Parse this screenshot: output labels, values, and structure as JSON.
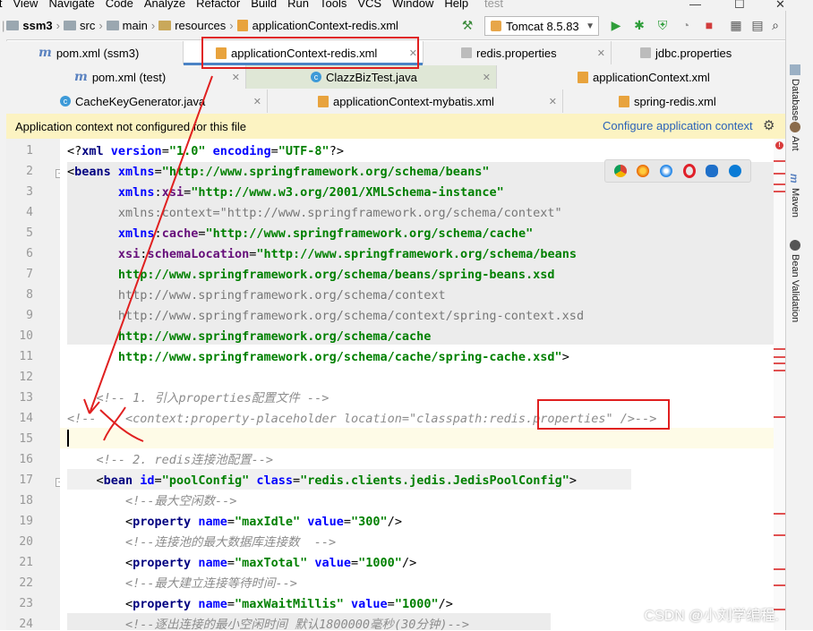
{
  "menu": {
    "items": [
      "it",
      "View",
      "Navigate",
      "Code",
      "Analyze",
      "Refactor",
      "Build",
      "Run",
      "Tools",
      "VCS",
      "Window",
      "Help"
    ],
    "project_title": "test"
  },
  "window_controls": {
    "minimize": "—",
    "maximize": "☐",
    "close": "✕"
  },
  "breadcrumb": {
    "project": "ssm3",
    "parts": [
      "src",
      "main",
      "resources"
    ],
    "file": "applicationContext-redis.xml"
  },
  "run_config": {
    "label": "Tomcat 8.5.83"
  },
  "tab_rows": [
    [
      {
        "label": "pom.xml (ssm3)",
        "icon": "m-icon",
        "active": false
      },
      {
        "label": "applicationContext-redis.xml",
        "icon": "xml-icon",
        "active": true
      },
      {
        "label": "redis.properties",
        "icon": "properties-icon",
        "active": false
      },
      {
        "label": "jdbc.properties",
        "icon": "properties-icon",
        "active": false
      }
    ],
    [
      {
        "label": "pom.xml (test)",
        "icon": "m-icon",
        "active": false
      },
      {
        "label": "ClazzBizTest.java",
        "icon": "class-icon",
        "active": false
      },
      {
        "label": "applicationContext.xml",
        "icon": "xml-icon",
        "active": false
      }
    ],
    [
      {
        "label": "CacheKeyGenerator.java",
        "icon": "class-icon",
        "active": false
      },
      {
        "label": "applicationContext-mybatis.xml",
        "icon": "xml-icon",
        "active": false
      },
      {
        "label": "spring-redis.xml",
        "icon": "xml-icon",
        "active": false
      }
    ]
  ],
  "notification": {
    "message": "Application context not configured for this file",
    "action": "Configure application context"
  },
  "right_tools": [
    "Database",
    "Ant",
    "Maven",
    "Bean Validation"
  ],
  "code": {
    "line_numbers": [
      "1",
      "2",
      "3",
      "4",
      "5",
      "6",
      "7",
      "8",
      "9",
      "10",
      "11",
      "12",
      "13",
      "14",
      "15",
      "16",
      "17",
      "18",
      "19",
      "20",
      "21",
      "22",
      "23",
      "24"
    ],
    "lines": [
      [
        {
          "t": "<?",
          "c": "t-plain"
        },
        {
          "t": "xml ",
          "c": "t-tag"
        },
        {
          "t": "version",
          "c": "t-attr"
        },
        {
          "t": "=",
          "c": "t-plain"
        },
        {
          "t": "\"1.0\"",
          "c": "t-val"
        },
        {
          "t": " ",
          "c": "t-plain"
        },
        {
          "t": "encoding",
          "c": "t-attr"
        },
        {
          "t": "=",
          "c": "t-plain"
        },
        {
          "t": "\"UTF-8\"",
          "c": "t-val"
        },
        {
          "t": "?>",
          "c": "t-plain"
        }
      ],
      [
        {
          "t": "<",
          "c": "t-plain"
        },
        {
          "t": "beans ",
          "c": "t-tag"
        },
        {
          "t": "xmlns",
          "c": "t-attr"
        },
        {
          "t": "=",
          "c": "t-plain"
        },
        {
          "t": "\"http://www.springframework.org/schema/beans\"",
          "c": "t-val"
        }
      ],
      [
        {
          "t": "       ",
          "c": "t-plain"
        },
        {
          "t": "xmlns",
          "c": "t-attr"
        },
        {
          "t": ":",
          "c": "t-plain"
        },
        {
          "t": "xsi",
          "c": "t-ns"
        },
        {
          "t": "=",
          "c": "t-plain"
        },
        {
          "t": "\"http://www.w3.org/2001/XMLSchema-instance\"",
          "c": "t-val"
        }
      ],
      [
        {
          "t": "       xmlns:context=\"http://www.springframework.org/schema/context\"",
          "c": "t-attr-gray"
        }
      ],
      [
        {
          "t": "       ",
          "c": "t-plain"
        },
        {
          "t": "xmlns",
          "c": "t-attr"
        },
        {
          "t": ":",
          "c": "t-plain"
        },
        {
          "t": "cache",
          "c": "t-ns"
        },
        {
          "t": "=",
          "c": "t-plain"
        },
        {
          "t": "\"http://www.springframework.org/schema/cache\"",
          "c": "t-val"
        }
      ],
      [
        {
          "t": "       ",
          "c": "t-plain"
        },
        {
          "t": "xsi",
          "c": "t-ns"
        },
        {
          "t": ":",
          "c": "t-plain"
        },
        {
          "t": "schemaLocation",
          "c": "t-ns"
        },
        {
          "t": "=",
          "c": "t-plain"
        },
        {
          "t": "\"http://www.springframework.org/schema/beans",
          "c": "t-val"
        }
      ],
      [
        {
          "t": "       http://www.springframework.org/schema/beans/spring-beans.xsd",
          "c": "t-val"
        }
      ],
      [
        {
          "t": "       http://www.springframework.org/schema/context",
          "c": "t-attr-gray"
        }
      ],
      [
        {
          "t": "       http://www.springframework.org/schema/context/spring-context.xsd",
          "c": "t-attr-gray"
        }
      ],
      [
        {
          "t": "       http://www.springframework.org/schema/cache",
          "c": "t-val"
        }
      ],
      [
        {
          "t": "       http://www.springframework.org/schema/cache/spring-cache.xsd\"",
          "c": "t-val"
        },
        {
          "t": ">",
          "c": "t-plain"
        }
      ],
      [
        {
          "t": "",
          "c": "t-plain"
        }
      ],
      [
        {
          "t": "    <!-- 1. 引入properties配置文件 -->",
          "c": "t-com"
        }
      ],
      [
        {
          "t": "<!--    <context:property-placeholder location=\"classpath:redis.properties\" />-->",
          "c": "t-com"
        }
      ],
      [
        {
          "t": "",
          "c": "t-plain"
        }
      ],
      [
        {
          "t": "    <!-- 2. redis连接池配置-->",
          "c": "t-com"
        }
      ],
      [
        {
          "t": "    <",
          "c": "t-plain"
        },
        {
          "t": "bean ",
          "c": "t-tag"
        },
        {
          "t": "id",
          "c": "t-attr"
        },
        {
          "t": "=",
          "c": "t-plain"
        },
        {
          "t": "\"poolConfig\"",
          "c": "t-val"
        },
        {
          "t": " ",
          "c": "t-plain"
        },
        {
          "t": "class",
          "c": "t-attr"
        },
        {
          "t": "=",
          "c": "t-plain"
        },
        {
          "t": "\"redis.clients.jedis.JedisPoolConfig\"",
          "c": "t-val"
        },
        {
          "t": ">",
          "c": "t-plain"
        }
      ],
      [
        {
          "t": "        <!--最大空闲数-->",
          "c": "t-com"
        }
      ],
      [
        {
          "t": "        <",
          "c": "t-plain"
        },
        {
          "t": "property ",
          "c": "t-tag"
        },
        {
          "t": "name",
          "c": "t-attr"
        },
        {
          "t": "=",
          "c": "t-plain"
        },
        {
          "t": "\"maxIdle\"",
          "c": "t-val"
        },
        {
          "t": " ",
          "c": "t-plain"
        },
        {
          "t": "value",
          "c": "t-attr"
        },
        {
          "t": "=",
          "c": "t-plain"
        },
        {
          "t": "\"300\"",
          "c": "t-val"
        },
        {
          "t": "/>",
          "c": "t-plain"
        }
      ],
      [
        {
          "t": "        <!--连接池的最大数据库连接数  -->",
          "c": "t-com"
        }
      ],
      [
        {
          "t": "        <",
          "c": "t-plain"
        },
        {
          "t": "property ",
          "c": "t-tag"
        },
        {
          "t": "name",
          "c": "t-attr"
        },
        {
          "t": "=",
          "c": "t-plain"
        },
        {
          "t": "\"maxTotal\"",
          "c": "t-val"
        },
        {
          "t": " ",
          "c": "t-plain"
        },
        {
          "t": "value",
          "c": "t-attr"
        },
        {
          "t": "=",
          "c": "t-plain"
        },
        {
          "t": "\"1000\"",
          "c": "t-val"
        },
        {
          "t": "/>",
          "c": "t-plain"
        }
      ],
      [
        {
          "t": "        <!--最大建立连接等待时间-->",
          "c": "t-com"
        }
      ],
      [
        {
          "t": "        <",
          "c": "t-plain"
        },
        {
          "t": "property ",
          "c": "t-tag"
        },
        {
          "t": "name",
          "c": "t-attr"
        },
        {
          "t": "=",
          "c": "t-plain"
        },
        {
          "t": "\"maxWaitMillis\"",
          "c": "t-val"
        },
        {
          "t": " ",
          "c": "t-plain"
        },
        {
          "t": "value",
          "c": "t-attr"
        },
        {
          "t": "=",
          "c": "t-plain"
        },
        {
          "t": "\"1000\"",
          "c": "t-val"
        },
        {
          "t": "/>",
          "c": "t-plain"
        }
      ],
      [
        {
          "t": "        <!--逐出连接的最小空闲时间 默认1800000毫秒(30分钟)-->",
          "c": "t-com"
        }
      ]
    ]
  },
  "watermark": "CSDN @小刘学编程.",
  "colors": {
    "accent": "#4b83c5",
    "annotation_red": "#e02020",
    "notification_bg": "#fcf3c2"
  }
}
